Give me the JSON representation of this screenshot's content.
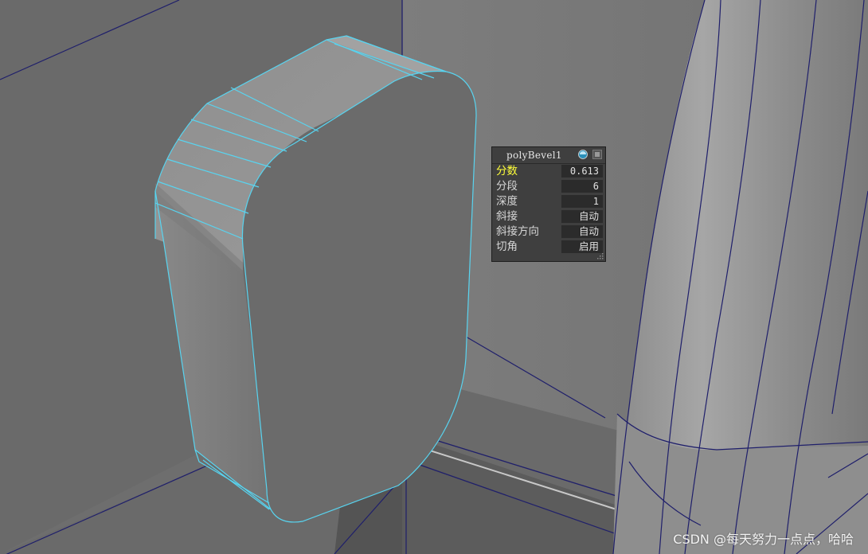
{
  "panel": {
    "title": "polyBevel1",
    "rows": [
      {
        "label": "分数",
        "value": "0.613",
        "active": true
      },
      {
        "label": "分段",
        "value": "6",
        "active": false
      },
      {
        "label": "深度",
        "value": "1",
        "active": false
      },
      {
        "label": "斜接",
        "value": "自动",
        "active": false
      },
      {
        "label": "斜接方向",
        "value": "自动",
        "active": false
      },
      {
        "label": "切角",
        "value": "启用",
        "active": false
      }
    ],
    "icons": {
      "status": "globe-icon",
      "menu": "hamburger-menu-icon",
      "resize": "resize-grip-icon"
    }
  },
  "watermark": "CSDN @每天努力一点点，哈哈",
  "colors": {
    "background": "#6e6e6e",
    "edge": "#1f1f6b",
    "selection": "#58d4f0",
    "active_label": "#ffff3a",
    "panel_bg": "#3f3f3f"
  }
}
